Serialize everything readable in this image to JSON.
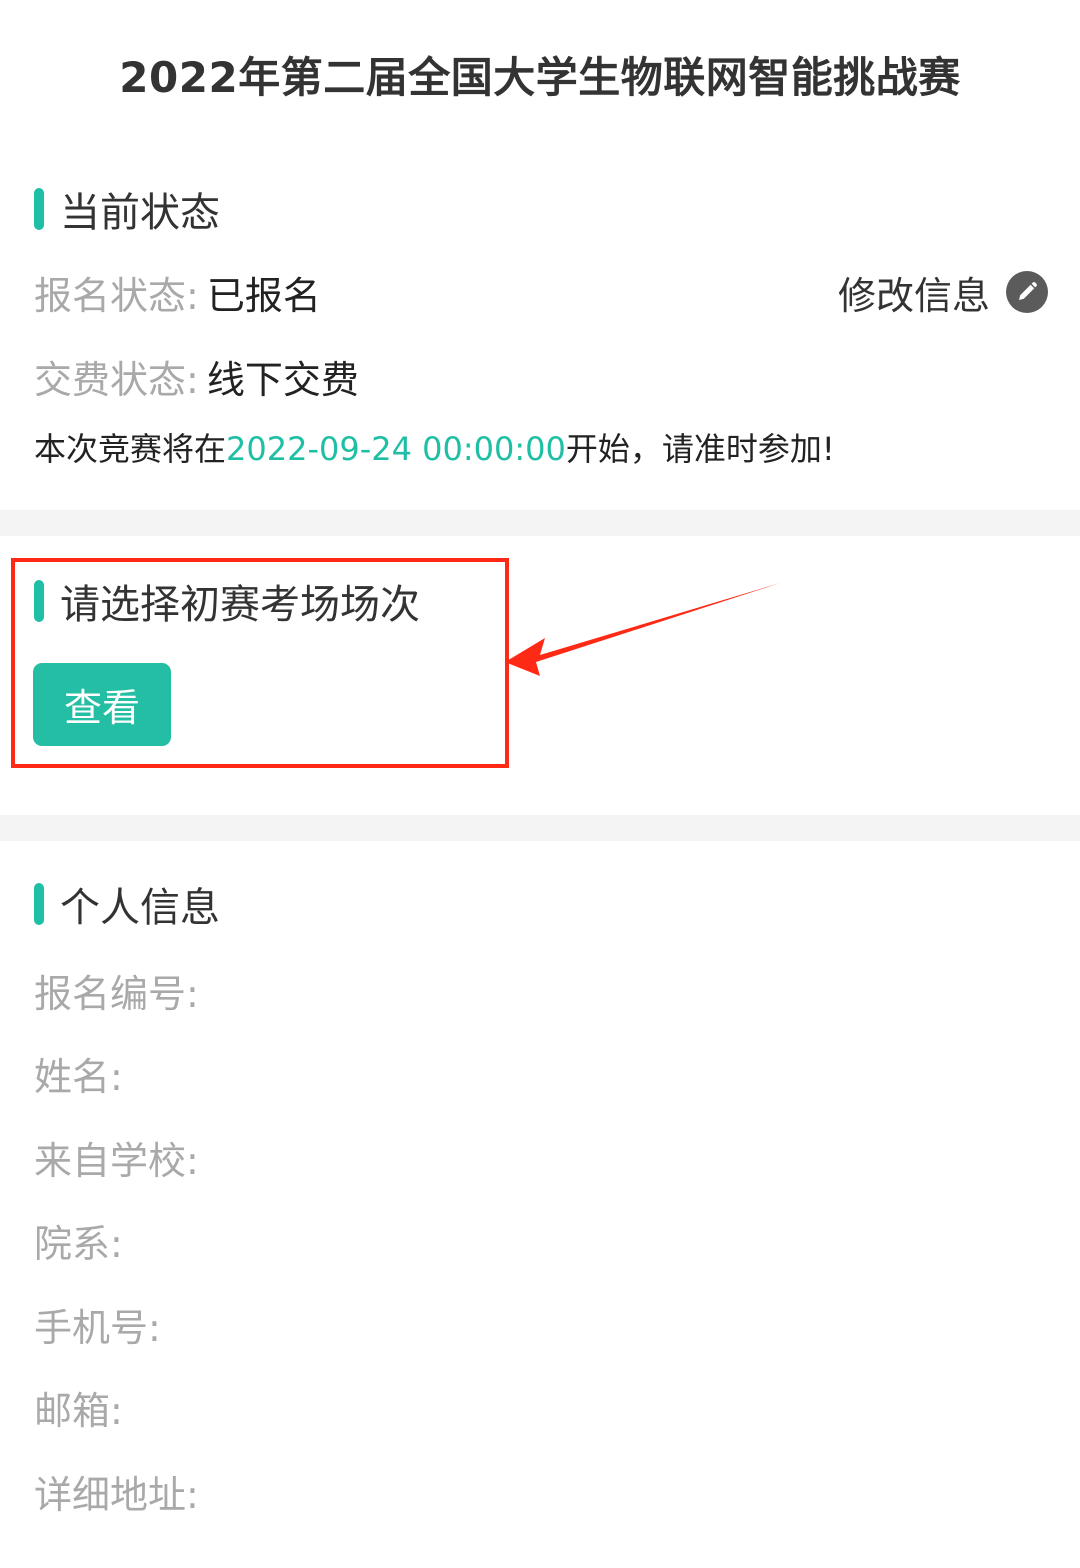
{
  "page": {
    "title": "2022年第二届全国大学生物联网智能挑战赛"
  },
  "status_section": {
    "title": "当前状态",
    "registration_label": "报名状态:",
    "registration_value": "已报名",
    "fee_label": "交费状态:",
    "fee_value": "线下交费",
    "edit_label": "修改信息",
    "edit_icon": "pencil-icon",
    "notice_prefix": "本次竞赛将在",
    "notice_date": "2022-09-24 00:00:00",
    "notice_suffix": "开始，请准时参加!"
  },
  "exam_section": {
    "title": "请选择初赛考场场次",
    "view_button": "查看"
  },
  "personal_section": {
    "title": "个人信息",
    "fields": [
      {
        "label": "报名编号:"
      },
      {
        "label": "姓名:"
      },
      {
        "label": "来自学校:"
      },
      {
        "label": "院系:"
      },
      {
        "label": "手机号:"
      },
      {
        "label": "邮箱:"
      },
      {
        "label": "详细地址:"
      }
    ]
  },
  "colors": {
    "accent": "#1fbfa5",
    "button": "#24bea4",
    "annotation": "#ff2a16",
    "label_gray": "#a9a9a9",
    "band_gray": "#f4f4f4"
  }
}
